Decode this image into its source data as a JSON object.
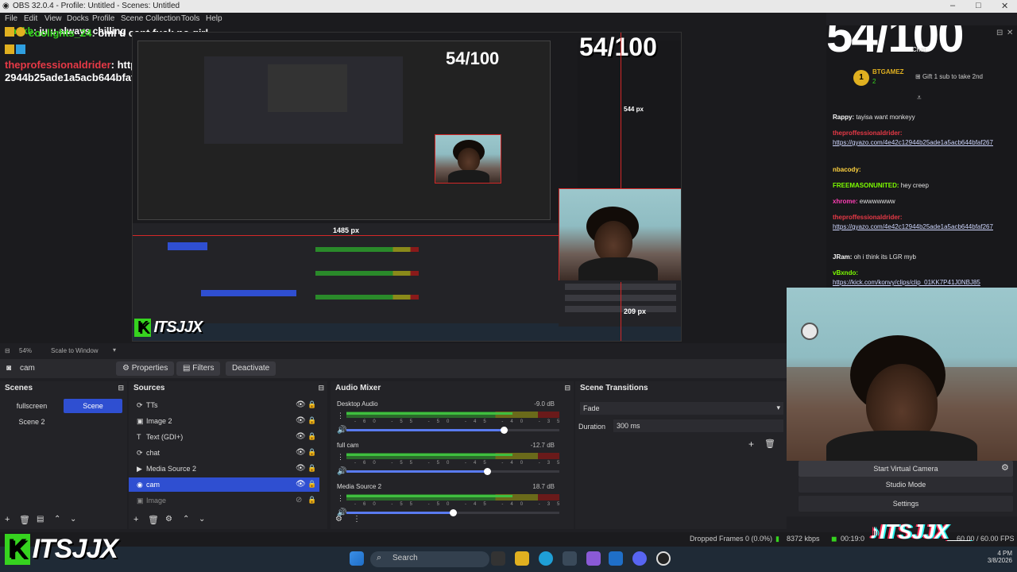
{
  "window": {
    "title": "OBS 32.0.4 - Profile: Untitled - Scenes: Untitled",
    "controls": [
      "–",
      "□",
      "✕"
    ]
  },
  "menu": [
    "File",
    "Edit",
    "View",
    "Docks",
    "Profile",
    "Scene Collection",
    "Tools",
    "Help"
  ],
  "overlay_chat": [
    {
      "user": "onnkb",
      "text": "ju u always chilling"
    },
    {
      "user": "coolights_24",
      "text": "oml u cant fuck no girl"
    },
    {
      "user": "theprofessionaldrider",
      "text": "https://gyazo.com/4e42c12944b25ade1a5acb644bfaf267"
    }
  ],
  "preview": {
    "counter": "54/100",
    "width_label": "1485 px",
    "height_label": "209 px",
    "cam_width_label": "544 px",
    "logo_k": "K",
    "logo_text": "ITSJJX"
  },
  "zoom": {
    "value": "54%",
    "mode": "Scale to Window"
  },
  "source_toolbar": {
    "selected_source": "cam",
    "properties": "Properties",
    "filters": "Filters",
    "deactivate": "Deactivate"
  },
  "scenes": {
    "title": "Scenes",
    "items": [
      "fullscreen",
      "Scene",
      "Scene 2"
    ],
    "selected": "Scene"
  },
  "sources": {
    "title": "Sources",
    "items": [
      {
        "icon": "⟳",
        "label": "TTs"
      },
      {
        "icon": "▣",
        "label": "Image 2"
      },
      {
        "icon": "T",
        "label": "Text (GDI+)"
      },
      {
        "icon": "⟳",
        "label": "chat"
      },
      {
        "icon": "▶",
        "label": "Media Source 2"
      },
      {
        "icon": "◉",
        "label": "cam"
      },
      {
        "icon": "▣",
        "label": "Image"
      }
    ],
    "selected": "cam"
  },
  "audio_mixer": {
    "title": "Audio Mixer",
    "channels": [
      {
        "name": "Desktop Audio",
        "db": "-9.0 dB",
        "level": 0.78,
        "volume": 0.74
      },
      {
        "name": "full cam",
        "db": "-12.7 dB",
        "level": 0.78,
        "volume": 0.66
      },
      {
        "name": "Media Source 2",
        "db": "18.7 dB",
        "level": 0.78,
        "volume": 0.5
      }
    ],
    "ticks": [
      "-60",
      "-55",
      "-50",
      "-45",
      "-40",
      "-35",
      "-30",
      "-25",
      "-20",
      "-15",
      "-10",
      "-5",
      "0"
    ]
  },
  "transitions": {
    "title": "Scene Transitions",
    "type": "Fade",
    "duration_label": "Duration",
    "duration": "300 ms"
  },
  "chat_panel": {
    "counter": "54/100",
    "title": "Chat",
    "gift_user": "BTGAMEZ",
    "gift_count": "2",
    "gift_text": "Gift 1 sub to take 2nd",
    "messages": [
      {
        "user": "Rappy:",
        "text": "tayisa want monkeyy",
        "color": "#f7f7f7",
        "link": false
      },
      {
        "user": "theproffessionaldrider:",
        "text": "https://gyazo.com/4e42c12944b25ade1a5acb644bfaf267",
        "color": "#e63946",
        "link": true
      },
      {
        "user": "nbacody:",
        "text": "",
        "color": "#ffd23f",
        "link": false
      },
      {
        "user": "FREEMASONUNITED:",
        "text": "hey creep",
        "color": "#7cfc00",
        "link": false
      },
      {
        "user": "xhrome:",
        "text": "ewwwwwww",
        "color": "#ff3fb4",
        "link": false
      },
      {
        "user": "theproffessionaldrider:",
        "text": "https://gyazo.com/4e42c12944b25ade1a5acb644bfaf267",
        "color": "#e63946",
        "link": true
      },
      {
        "user": "JRam:",
        "text": "oh i think its LGR myb",
        "color": "#f7f7f7",
        "link": false
      },
      {
        "user": "vBxndo:",
        "text": "https://kick.com/konvy/clips/clip_01KK7P41J0NBJ85",
        "color": "#7cfc00",
        "link": true
      }
    ]
  },
  "controls": {
    "virtual_camera": "Start Virtual Camera",
    "studio_mode": "Studio Mode",
    "settings": "Settings"
  },
  "status": {
    "dropped": "Dropped Frames 0 (0.0%)",
    "kbps": "8372 kbps",
    "time": "00:19:0",
    "fps": "60.00 / 60.00 FPS"
  },
  "taskbar": {
    "search": "Search",
    "clock_time": "4 PM",
    "clock_date": "3/8/2026"
  },
  "watermark": {
    "k": "K",
    "text": "ITSJJX",
    "tiktok": "ITSJJX__"
  },
  "colors": {
    "accent": "#2f4fd1",
    "kick_green": "#36d31f",
    "selection_red": "#d42828"
  }
}
